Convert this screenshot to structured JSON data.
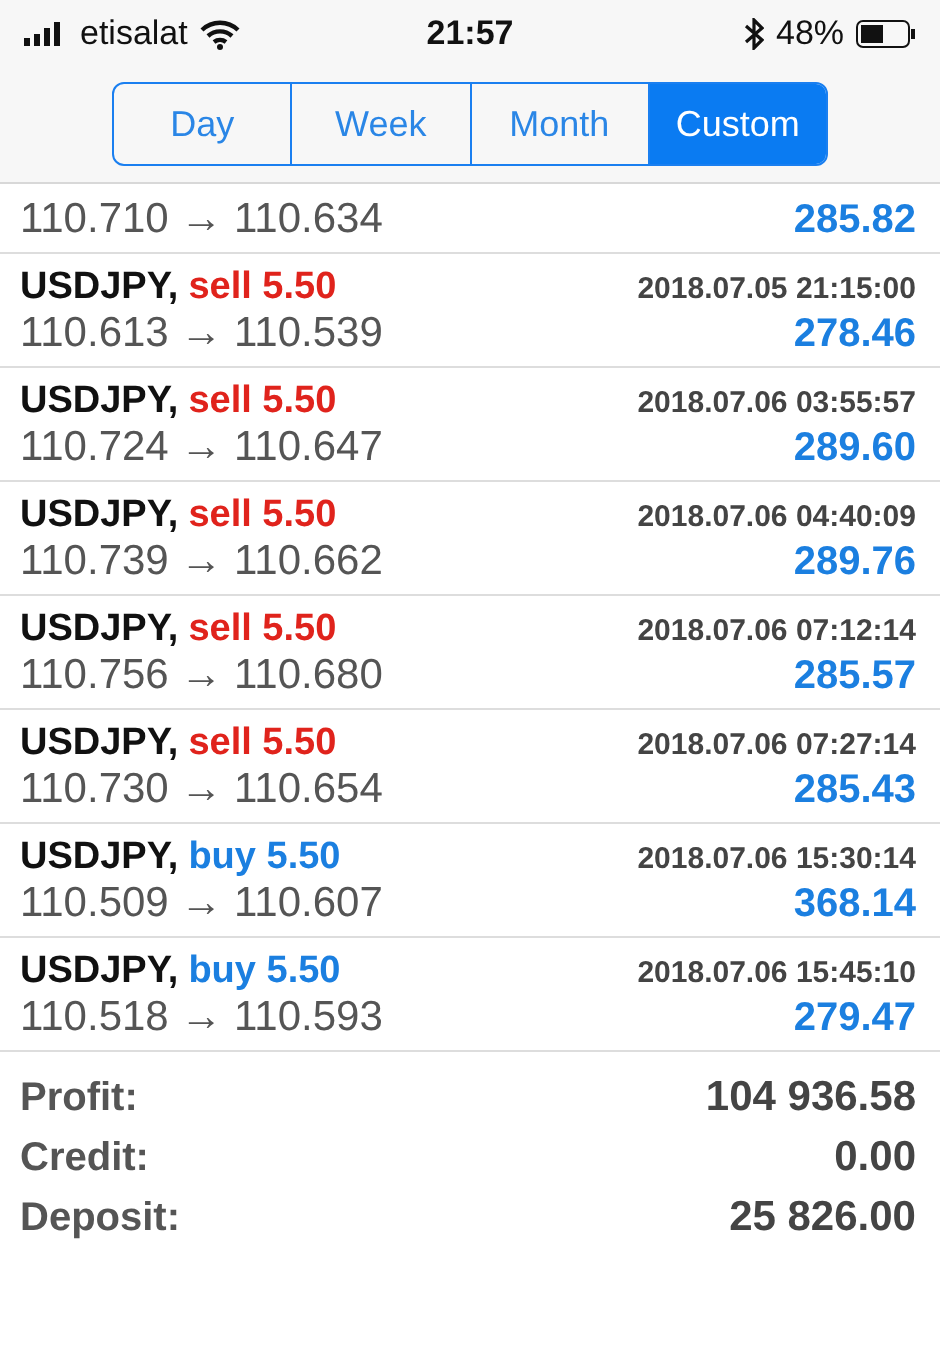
{
  "status_bar": {
    "carrier": "etisalat",
    "time": "21:57",
    "battery": "48%"
  },
  "tabs": [
    {
      "label": "Day",
      "selected": false
    },
    {
      "label": "Week",
      "selected": false
    },
    {
      "label": "Month",
      "selected": false
    },
    {
      "label": "Custom",
      "selected": true
    }
  ],
  "trades": [
    {
      "prices": "110.710 → 110.634",
      "profit": "285.82"
    },
    {
      "symbol": "USDJPY,",
      "kind": "short",
      "order": "sell 5.50",
      "time": "2018.07.05 21:15:00",
      "prices": "110.613 → 110.539",
      "profit": "278.46"
    },
    {
      "symbol": "USDJPY,",
      "kind": "short",
      "order": "sell 5.50",
      "time": "2018.07.06 03:55:57",
      "prices": "110.724 → 110.647",
      "profit": "289.60"
    },
    {
      "symbol": "USDJPY,",
      "kind": "short",
      "order": "sell 5.50",
      "time": "2018.07.06 04:40:09",
      "prices": "110.739 → 110.662",
      "profit": "289.76"
    },
    {
      "symbol": "USDJPY,",
      "kind": "short",
      "order": "sell 5.50",
      "time": "2018.07.06 07:12:14",
      "prices": "110.756 → 110.680",
      "profit": "285.57"
    },
    {
      "symbol": "USDJPY,",
      "kind": "short",
      "order": "sell 5.50",
      "time": "2018.07.06 07:27:14",
      "prices": "110.730 → 110.654",
      "profit": "285.43"
    },
    {
      "symbol": "USDJPY,",
      "kind": "long",
      "order": "buy 5.50",
      "time": "2018.07.06 15:30:14",
      "prices": "110.509 → 110.607",
      "profit": "368.14"
    },
    {
      "symbol": "USDJPY,",
      "kind": "long",
      "order": "buy 5.50",
      "time": "2018.07.06 15:45:10",
      "prices": "110.518 → 110.593",
      "profit": "279.47"
    }
  ],
  "summary": [
    {
      "label": "Profit:",
      "value": "104 936.58"
    },
    {
      "label": "Credit:",
      "value": "0.00"
    },
    {
      "label": "Deposit:",
      "value": "25 826.00"
    }
  ]
}
